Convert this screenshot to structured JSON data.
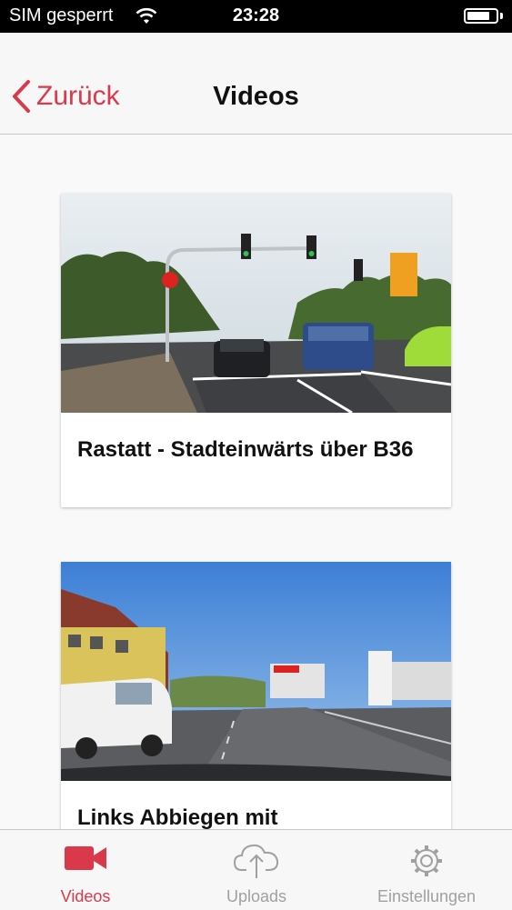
{
  "status_bar": {
    "carrier": "SIM gesperrt",
    "time": "23:28",
    "battery_level": 0.8
  },
  "nav": {
    "back_label": "Zurück",
    "title": "Videos"
  },
  "videos": [
    {
      "title": "Rastatt - Stadteinwärts über B36"
    },
    {
      "title": "Links Abbiegen mit"
    }
  ],
  "tabs": [
    {
      "label": "Videos",
      "icon": "video-camera-icon",
      "active": true
    },
    {
      "label": "Uploads",
      "icon": "cloud-upload-icon",
      "active": false
    },
    {
      "label": "Einstellungen",
      "icon": "gear-icon",
      "active": false
    }
  ],
  "colors": {
    "accent": "#d9394a",
    "inactive": "#a0a0a0"
  }
}
